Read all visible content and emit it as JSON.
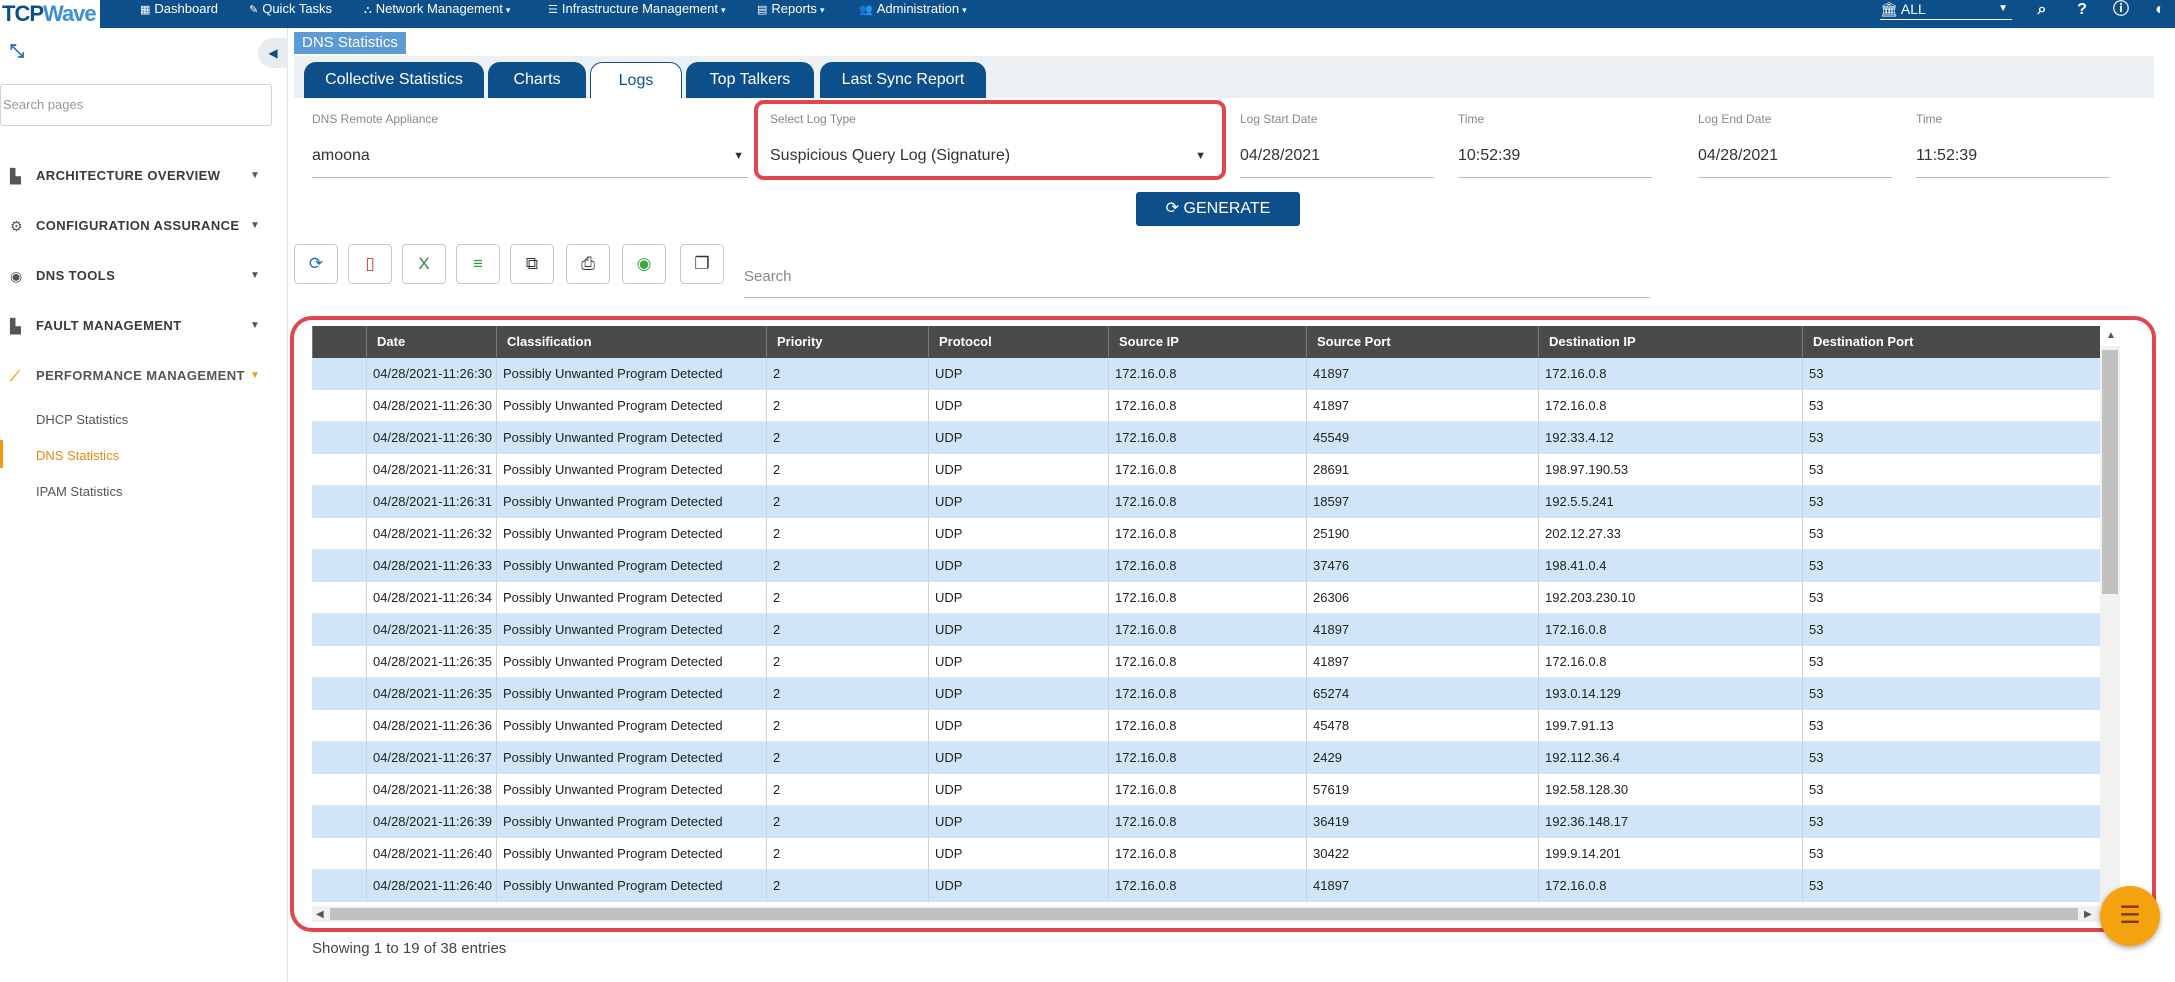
{
  "logo": {
    "part1": "TCP",
    "part2": "Wave"
  },
  "topnav": {
    "items": [
      {
        "label": "Dashboard",
        "icon": "▦"
      },
      {
        "label": "Quick Tasks",
        "icon": "✎"
      },
      {
        "label": "Network Management",
        "icon": "⛬"
      },
      {
        "label": "Infrastructure Management",
        "icon": "☰"
      },
      {
        "label": "Reports",
        "icon": "▤"
      },
      {
        "label": "Administration",
        "icon": "👥"
      }
    ],
    "scope": "ALL",
    "scope_icon": "🏛"
  },
  "sidebar": {
    "search_placeholder": "Search pages",
    "items": [
      {
        "label": "ARCHITECTURE OVERVIEW",
        "icon": "▙"
      },
      {
        "label": "CONFIGURATION ASSURANCE",
        "icon": "⚙"
      },
      {
        "label": "DNS TOOLS",
        "icon": "◉"
      },
      {
        "label": "FAULT MANAGEMENT",
        "icon": "▙"
      },
      {
        "label": "PERFORMANCE MANAGEMENT",
        "icon": "⟋"
      }
    ],
    "sub_items": [
      "DHCP Statistics",
      "DNS Statistics",
      "IPAM Statistics"
    ]
  },
  "breadcrumb": "DNS Statistics",
  "tabs": [
    "Collective Statistics",
    "Charts",
    "Logs",
    "Top Talkers",
    "Last Sync Report"
  ],
  "filters": {
    "appliance_label": "DNS Remote Appliance",
    "appliance_value": "amoona",
    "logtype_label": "Select Log Type",
    "logtype_value": "Suspicious Query Log (Signature)",
    "start_date_label": "Log Start Date",
    "start_date": "04/28/2021",
    "start_time_label": "Time",
    "start_time": "10:52:39",
    "end_date_label": "Log End Date",
    "end_date": "04/28/2021",
    "end_time_label": "Time",
    "end_time": "11:52:39"
  },
  "generate_label": "GENERATE",
  "table_search_placeholder": "Search",
  "table": {
    "columns": [
      "Date",
      "Classification",
      "Priority",
      "Protocol",
      "Source IP",
      "Source Port",
      "Destination IP",
      "Destination Port"
    ],
    "rows": [
      [
        "04/28/2021-11:26:30",
        "Possibly Unwanted Program Detected",
        "2",
        "UDP",
        "172.16.0.8",
        "41897",
        "172.16.0.8",
        "53"
      ],
      [
        "04/28/2021-11:26:30",
        "Possibly Unwanted Program Detected",
        "2",
        "UDP",
        "172.16.0.8",
        "41897",
        "172.16.0.8",
        "53"
      ],
      [
        "04/28/2021-11:26:30",
        "Possibly Unwanted Program Detected",
        "2",
        "UDP",
        "172.16.0.8",
        "45549",
        "192.33.4.12",
        "53"
      ],
      [
        "04/28/2021-11:26:31",
        "Possibly Unwanted Program Detected",
        "2",
        "UDP",
        "172.16.0.8",
        "28691",
        "198.97.190.53",
        "53"
      ],
      [
        "04/28/2021-11:26:31",
        "Possibly Unwanted Program Detected",
        "2",
        "UDP",
        "172.16.0.8",
        "18597",
        "192.5.5.241",
        "53"
      ],
      [
        "04/28/2021-11:26:32",
        "Possibly Unwanted Program Detected",
        "2",
        "UDP",
        "172.16.0.8",
        "25190",
        "202.12.27.33",
        "53"
      ],
      [
        "04/28/2021-11:26:33",
        "Possibly Unwanted Program Detected",
        "2",
        "UDP",
        "172.16.0.8",
        "37476",
        "198.41.0.4",
        "53"
      ],
      [
        "04/28/2021-11:26:34",
        "Possibly Unwanted Program Detected",
        "2",
        "UDP",
        "172.16.0.8",
        "26306",
        "192.203.230.10",
        "53"
      ],
      [
        "04/28/2021-11:26:35",
        "Possibly Unwanted Program Detected",
        "2",
        "UDP",
        "172.16.0.8",
        "41897",
        "172.16.0.8",
        "53"
      ],
      [
        "04/28/2021-11:26:35",
        "Possibly Unwanted Program Detected",
        "2",
        "UDP",
        "172.16.0.8",
        "41897",
        "172.16.0.8",
        "53"
      ],
      [
        "04/28/2021-11:26:35",
        "Possibly Unwanted Program Detected",
        "2",
        "UDP",
        "172.16.0.8",
        "65274",
        "193.0.14.129",
        "53"
      ],
      [
        "04/28/2021-11:26:36",
        "Possibly Unwanted Program Detected",
        "2",
        "UDP",
        "172.16.0.8",
        "45478",
        "199.7.91.13",
        "53"
      ],
      [
        "04/28/2021-11:26:37",
        "Possibly Unwanted Program Detected",
        "2",
        "UDP",
        "172.16.0.8",
        "2429",
        "192.112.36.4",
        "53"
      ],
      [
        "04/28/2021-11:26:38",
        "Possibly Unwanted Program Detected",
        "2",
        "UDP",
        "172.16.0.8",
        "57619",
        "192.58.128.30",
        "53"
      ],
      [
        "04/28/2021-11:26:39",
        "Possibly Unwanted Program Detected",
        "2",
        "UDP",
        "172.16.0.8",
        "36419",
        "192.36.148.17",
        "53"
      ],
      [
        "04/28/2021-11:26:40",
        "Possibly Unwanted Program Detected",
        "2",
        "UDP",
        "172.16.0.8",
        "30422",
        "199.9.14.201",
        "53"
      ],
      [
        "04/28/2021-11:26:40",
        "Possibly Unwanted Program Detected",
        "2",
        "UDP",
        "172.16.0.8",
        "41897",
        "172.16.0.8",
        "53"
      ]
    ]
  },
  "entries_info": "Showing 1 to 19 of 38 entries",
  "colors": {
    "nav": "#0d4f8b",
    "accent": "#f39c12",
    "highlight": "#e0474c",
    "row_alt": "#d0e6f8"
  }
}
